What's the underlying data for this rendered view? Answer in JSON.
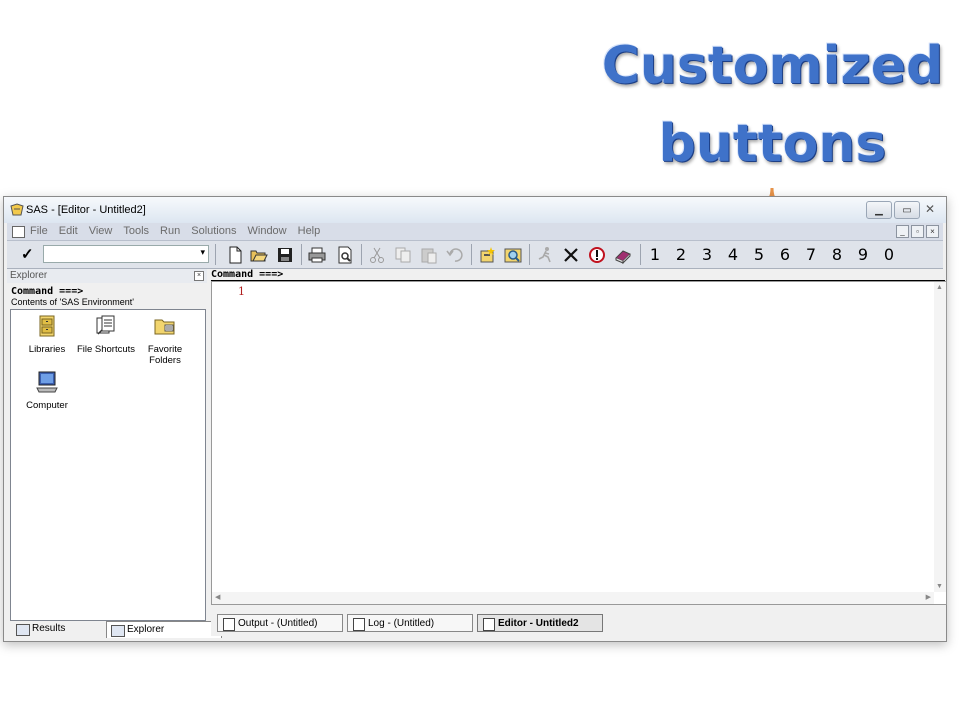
{
  "annotation": {
    "line1": "Customized",
    "line2": "buttons",
    "color": "#3f72c9",
    "bracket_color": "#e8944a"
  },
  "window": {
    "title": "SAS - [Editor - Untitled2]",
    "controls": {
      "minimize": "▁",
      "maximize": "▭",
      "close": "✕"
    }
  },
  "menubar": {
    "items": [
      "File",
      "Edit",
      "View",
      "Tools",
      "Run",
      "Solutions",
      "Window",
      "Help"
    ],
    "mdi_controls": [
      "_",
      "▫",
      "×"
    ]
  },
  "toolbar": {
    "check_label": "✓",
    "dropdown_arrow": "▾",
    "icons": [
      "new-document-icon",
      "open-folder-icon",
      "save-icon",
      "print-icon",
      "print-preview-icon",
      "cut-icon",
      "copy-icon",
      "paste-icon",
      "undo-icon",
      "new-library-icon",
      "explorer-icon",
      "submit-run-icon",
      "clear-x-icon",
      "break-icon",
      "help-book-icon"
    ],
    "custom_buttons": [
      "1",
      "2",
      "3",
      "4",
      "5",
      "6",
      "7",
      "8",
      "9",
      "0"
    ]
  },
  "explorer": {
    "title": "Explorer",
    "close": "×",
    "command_label": "Command ===>",
    "contents_label": "Contents of 'SAS Environment'",
    "items": [
      {
        "label": "Libraries",
        "icon": "libraries-icon"
      },
      {
        "label": "File Shortcuts",
        "icon": "file-shortcuts-icon"
      },
      {
        "label": "Favorite Folders",
        "icon": "favorite-folders-icon"
      },
      {
        "label": "Computer",
        "icon": "computer-icon"
      }
    ],
    "tabs": [
      {
        "label": "Results",
        "active": false
      },
      {
        "label": "Explorer",
        "active": true
      }
    ]
  },
  "editor": {
    "command_label": "Command ===>",
    "line_number": "1"
  },
  "taskbar": {
    "items": [
      {
        "label": "Output - (Untitled)",
        "active": false
      },
      {
        "label": "Log - (Untitled)",
        "active": false
      },
      {
        "label": "Editor - Untitled2",
        "active": true
      }
    ]
  }
}
